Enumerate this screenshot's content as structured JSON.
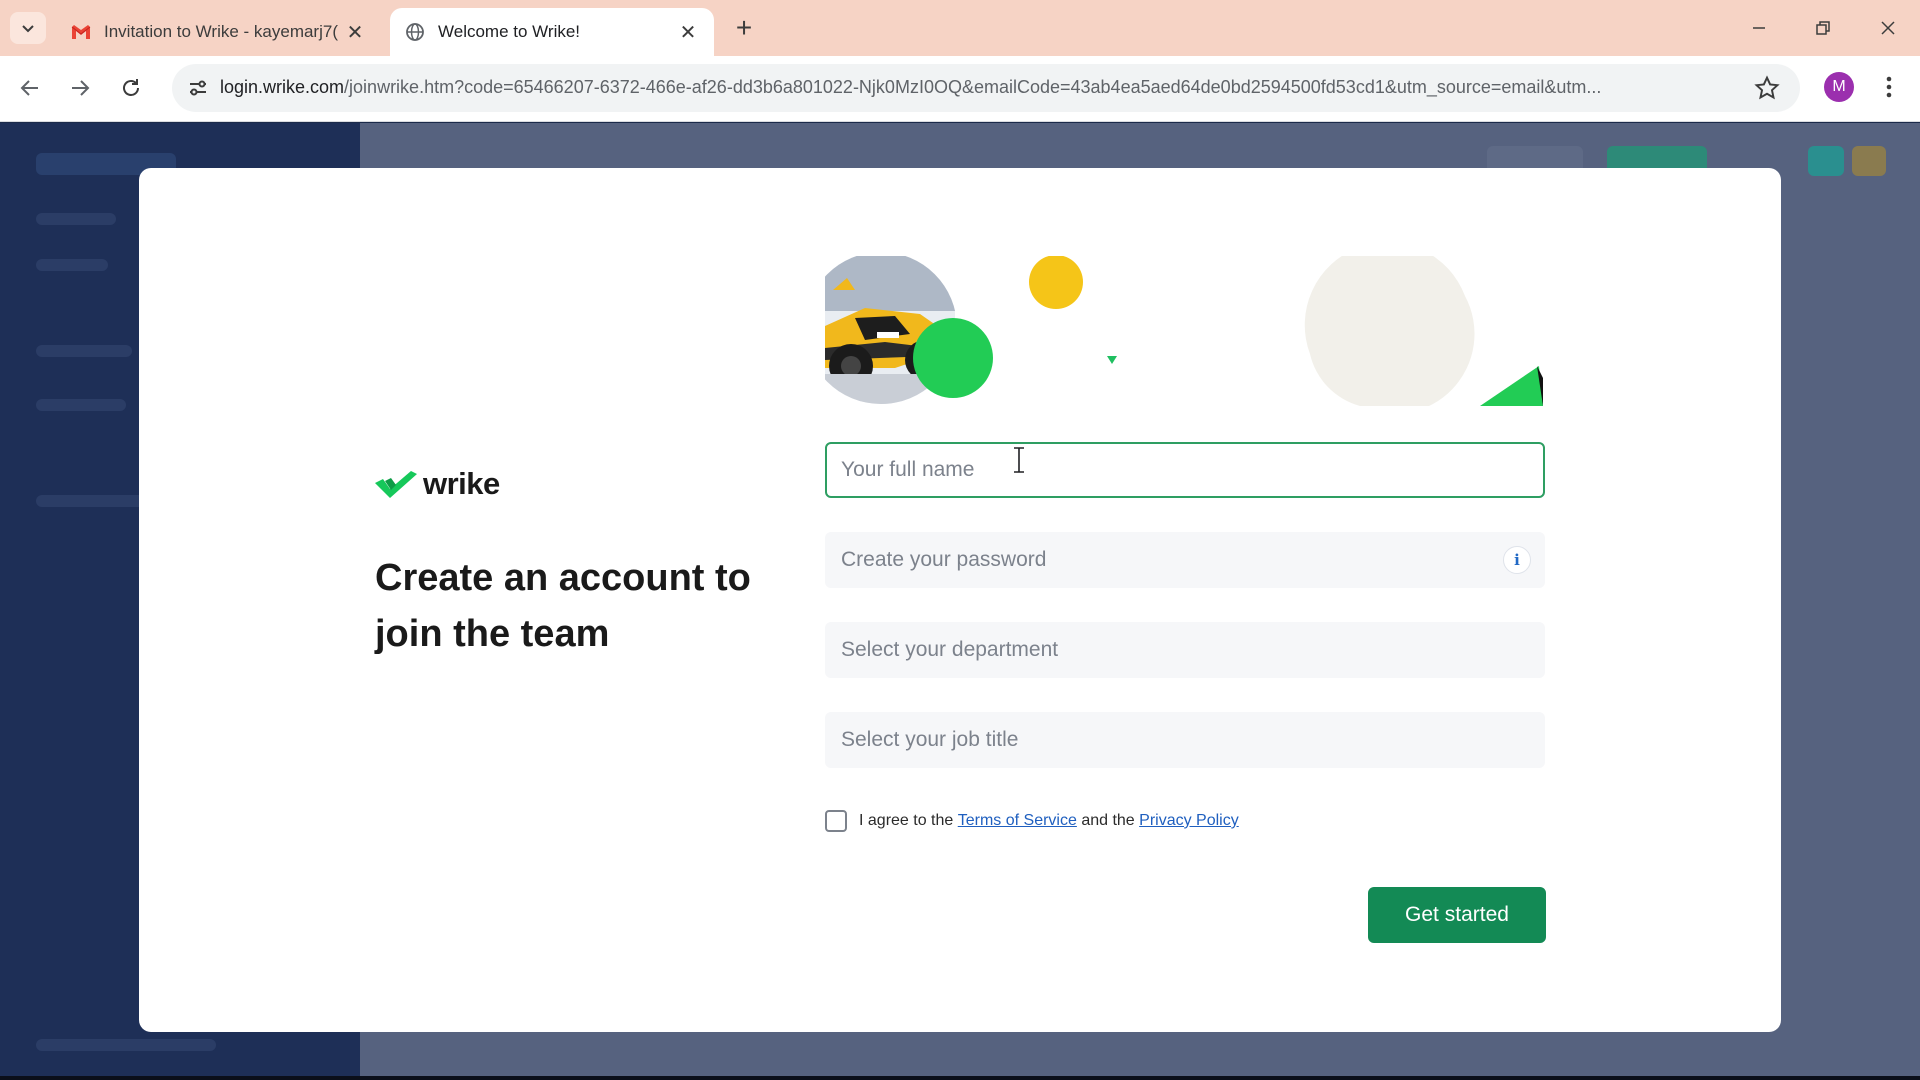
{
  "browser": {
    "tabs": [
      {
        "title": "Invitation to Wrike - kayemarj7(",
        "favicon": "gmail-icon",
        "active": false
      },
      {
        "title": "Welcome to Wrike!",
        "favicon": "globe-icon",
        "active": true
      }
    ],
    "address": {
      "host": "login.wrike.com",
      "path": "/joinwrike.htm?code=65466207-6372-466e-af26-dd3b6a801022-Njk0MzI0OQ&emailCode=43ab4ea5aed64de0bd2594500fd53cd1&utm_source=email&utm..."
    },
    "profile_initial": "M",
    "colors": {
      "tabbar": "#f6d3c5",
      "profile": "#9b2fae"
    }
  },
  "modal": {
    "brand": "wrike",
    "headline": "Create an account to join the team",
    "fields": {
      "full_name": {
        "placeholder": "Your full name",
        "value": ""
      },
      "password": {
        "placeholder": "Create your password",
        "value": ""
      },
      "department": {
        "placeholder": "Select your department",
        "value": ""
      },
      "job_title": {
        "placeholder": "Select your job title",
        "value": ""
      }
    },
    "agree": {
      "prefix": "I agree to the ",
      "terms_link": "Terms of Service",
      "middle": " and the ",
      "privacy_link": "Privacy Policy",
      "checked": false
    },
    "submit_label": "Get started",
    "colors": {
      "brand_green": "#138a55",
      "focus_border": "#2e9e62",
      "link": "#1f5fbf",
      "accent_yellow": "#f5c518",
      "accent_green": "#22cc55"
    }
  }
}
